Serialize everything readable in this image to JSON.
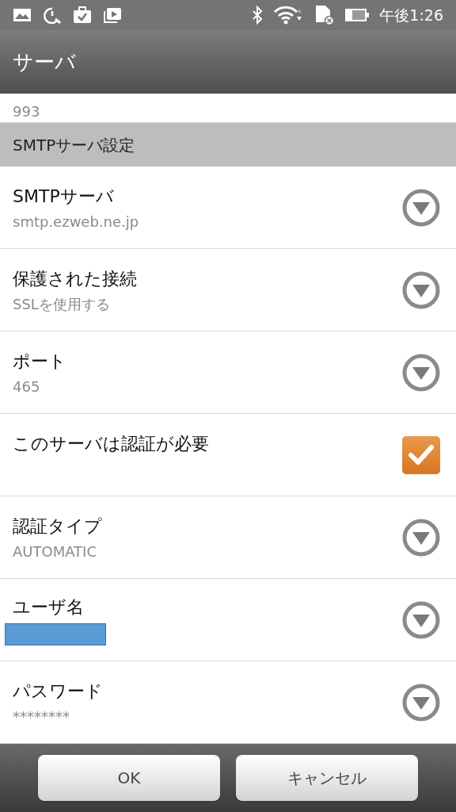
{
  "status_bar": {
    "time": "午後1:26"
  },
  "app_bar": {
    "title": "サーバ"
  },
  "partial_row": {
    "value": "993"
  },
  "section": {
    "title": "SMTPサーバ設定"
  },
  "rows": [
    {
      "kind": "dropdown",
      "title": "SMTPサーバ",
      "value": "smtp.ezweb.ne.jp"
    },
    {
      "kind": "dropdown",
      "title": "保護された接続",
      "value": "SSLを使用する"
    },
    {
      "kind": "dropdown",
      "title": "ポート",
      "value": "465"
    },
    {
      "kind": "checkbox",
      "title": "このサーバは認証が必要",
      "checked": true
    },
    {
      "kind": "dropdown",
      "title": "認証タイプ",
      "value": "AUTOMATIC"
    },
    {
      "kind": "dropdown",
      "title": "ユーザ名",
      "redacted": true
    },
    {
      "kind": "dropdown",
      "title": "パスワード",
      "value": "********"
    }
  ],
  "buttons": [
    {
      "label": "OK"
    },
    {
      "label": "キャンセル"
    }
  ]
}
